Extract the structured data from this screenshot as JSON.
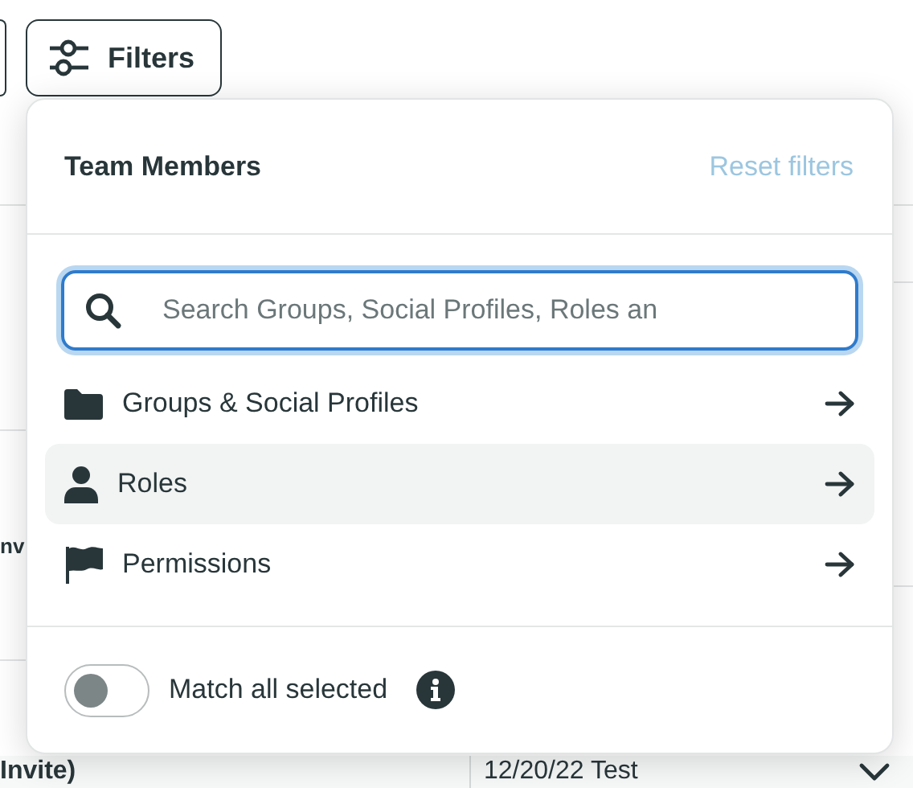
{
  "background": {
    "row_fragment": "nv",
    "bottom_row": {
      "name": "Invite)",
      "date": "12/20/22 Test"
    }
  },
  "filters_button": {
    "label": "Filters"
  },
  "popover": {
    "title": "Team Members",
    "reset_link": "Reset filters",
    "search": {
      "placeholder": "Search Groups, Social Profiles, Roles an",
      "focused": true
    },
    "items": [
      {
        "label": "Groups & Social Profiles",
        "selected": false
      },
      {
        "label": "Roles",
        "selected": true
      },
      {
        "label": "Permissions",
        "selected": false
      }
    ],
    "match_all": {
      "label": "Match all selected",
      "on": false
    }
  }
}
